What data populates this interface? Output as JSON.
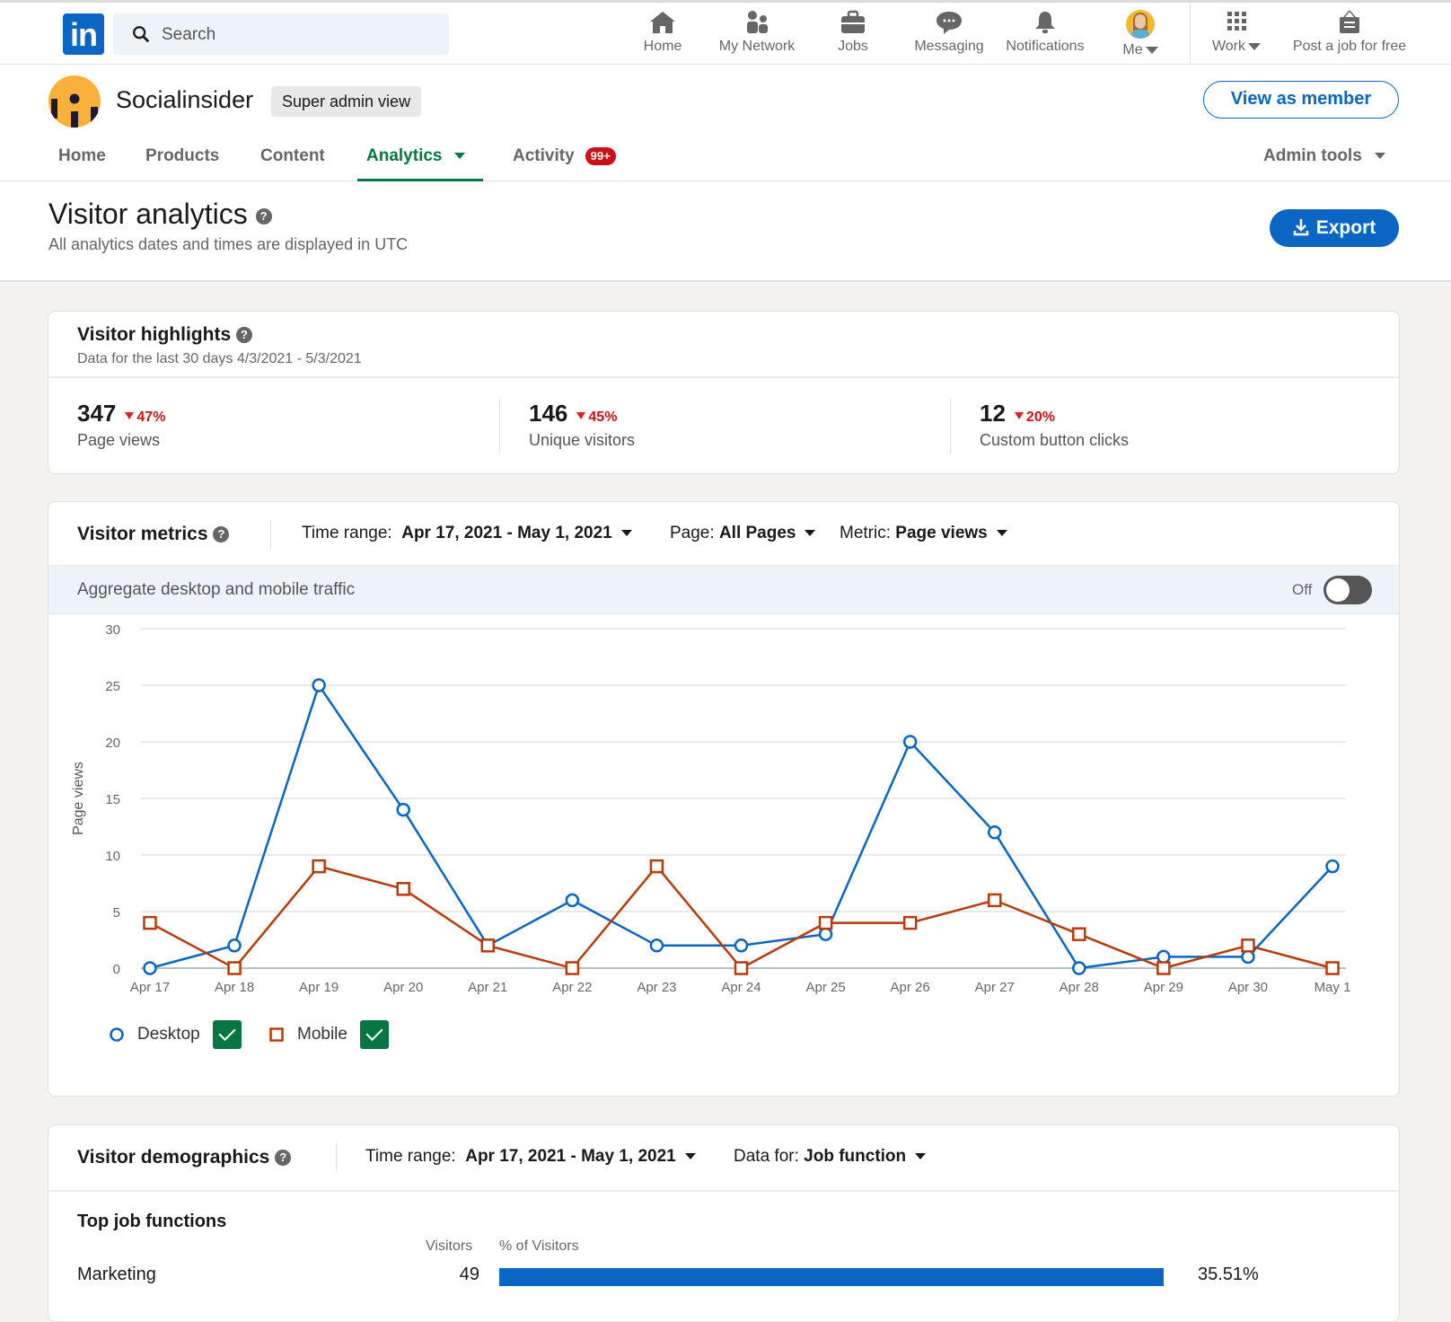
{
  "topnav": {
    "search_placeholder": "Search",
    "items": [
      {
        "label": "Home",
        "icon": "home-icon"
      },
      {
        "label": "My Network",
        "icon": "network-icon"
      },
      {
        "label": "Jobs",
        "icon": "briefcase-icon"
      },
      {
        "label": "Messaging",
        "icon": "messaging-icon"
      },
      {
        "label": "Notifications",
        "icon": "bell-icon"
      },
      {
        "label": "Me",
        "icon": "avatar"
      },
      {
        "label": "Work",
        "icon": "grid-icon"
      },
      {
        "label": "Post a job for free",
        "icon": "post-job-icon"
      }
    ]
  },
  "company": {
    "name": "Socialinsider",
    "admin_badge": "Super admin view",
    "view_as_member": "View as member"
  },
  "tabs": [
    {
      "label": "Home"
    },
    {
      "label": "Products"
    },
    {
      "label": "Content"
    },
    {
      "label": "Analytics",
      "active": true
    },
    {
      "label": "Activity",
      "badge": "99+"
    },
    {
      "label": "Admin tools"
    }
  ],
  "page": {
    "title": "Visitor analytics",
    "subtitle": "All analytics dates and times are displayed in UTC",
    "export_label": "Export"
  },
  "highlights": {
    "title": "Visitor highlights",
    "range": "Data for the last 30 days 4/3/2021 - 5/3/2021",
    "stats": [
      {
        "value": "347",
        "delta": "47%",
        "direction": "down",
        "label": "Page views"
      },
      {
        "value": "146",
        "delta": "45%",
        "direction": "down",
        "label": "Unique visitors"
      },
      {
        "value": "12",
        "delta": "20%",
        "direction": "down",
        "label": "Custom button clicks"
      }
    ]
  },
  "metrics": {
    "title": "Visitor metrics",
    "time_range_label": "Time range:",
    "time_range_value": "Apr 17, 2021 - May 1, 2021",
    "page_label": "Page:",
    "page_value": "All Pages",
    "metric_label": "Metric:",
    "metric_value": "Page views",
    "aggregate_label": "Aggregate desktop and mobile traffic",
    "toggle_state": "Off",
    "legend": [
      {
        "name": "Desktop",
        "checked": true
      },
      {
        "name": "Mobile",
        "checked": true
      }
    ]
  },
  "colors": {
    "desktop": "#0a66c2",
    "mobile": "#b83c0a",
    "accent": "#0a66c2",
    "active_tab": "#057642",
    "negative": "#cc1016"
  },
  "chart_data": {
    "type": "line",
    "title": "",
    "xlabel": "",
    "ylabel": "Page views",
    "ylim": [
      0,
      30
    ],
    "yticks": [
      0,
      5,
      10,
      15,
      20,
      25,
      30
    ],
    "grid": true,
    "legend_position": "bottom-left",
    "x": [
      "Apr 17",
      "Apr 18",
      "Apr 19",
      "Apr 20",
      "Apr 21",
      "Apr 22",
      "Apr 23",
      "Apr 24",
      "Apr 25",
      "Apr 26",
      "Apr 27",
      "Apr 28",
      "Apr 29",
      "Apr 30",
      "May 1"
    ],
    "series": [
      {
        "name": "Desktop",
        "marker": "circle",
        "values": [
          0,
          2,
          25,
          14,
          2,
          6,
          2,
          2,
          3,
          20,
          12,
          0,
          1,
          1,
          9
        ]
      },
      {
        "name": "Mobile",
        "marker": "square",
        "values": [
          4,
          0,
          9,
          7,
          2,
          0,
          9,
          0,
          4,
          4,
          6,
          3,
          0,
          2,
          0
        ]
      }
    ]
  },
  "demographics": {
    "title": "Visitor demographics",
    "time_range_label": "Time range:",
    "time_range_value": "Apr 17, 2021 - May 1, 2021",
    "data_for_label": "Data for:",
    "data_for_value": "Job function",
    "section_title": "Top job functions",
    "col_visitors": "Visitors",
    "col_percent": "% of Visitors",
    "rows": [
      {
        "label": "Marketing",
        "visitors": "49",
        "percent": "35.51%",
        "fraction": 0.3551
      }
    ]
  }
}
